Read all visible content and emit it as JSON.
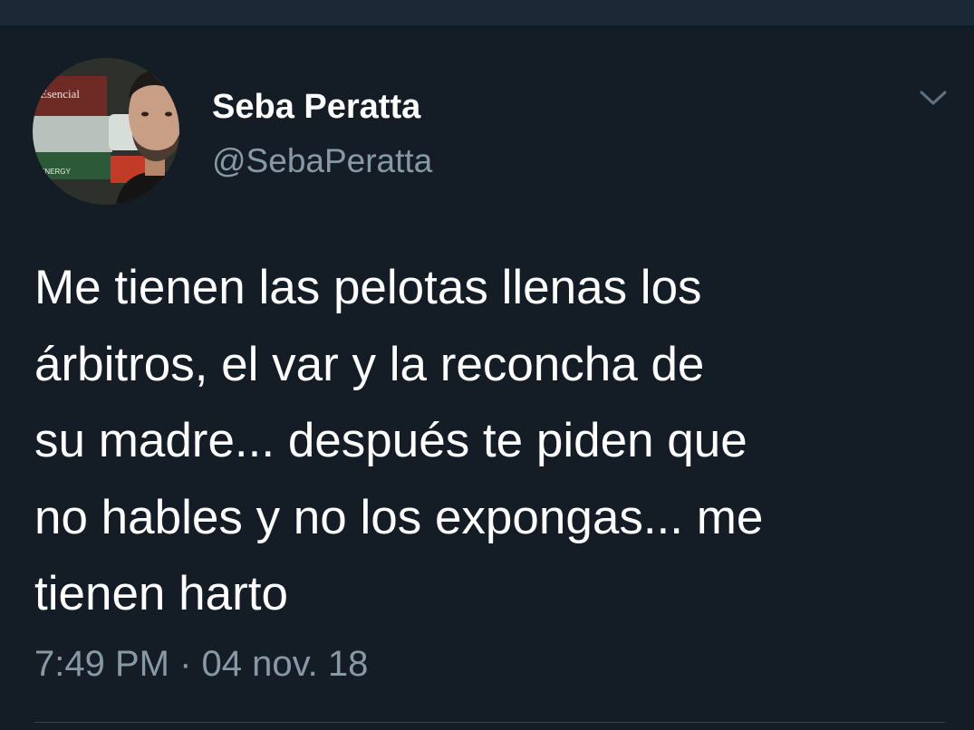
{
  "tweet": {
    "author": {
      "display_name": "Seba Peratta",
      "handle": "@SebaPeratta",
      "avatar_backdrop_text": [
        "Esencial",
        "ENERGY"
      ]
    },
    "text": "Me tienen las pelotas llenas los\nárbitros, el var y la reconcha de\nsu madre... después te piden que\nno hables y no los expongas... me\ntienen harto",
    "timestamp": "7:49 PM · 04 nov. 18"
  },
  "icons": {
    "menu": "chevron-down-icon"
  },
  "colors": {
    "background": "#141d26",
    "top_strip": "#1b2836",
    "text_primary": "#ffffff",
    "text_secondary": "#8899a6",
    "divider": "#38444d"
  }
}
